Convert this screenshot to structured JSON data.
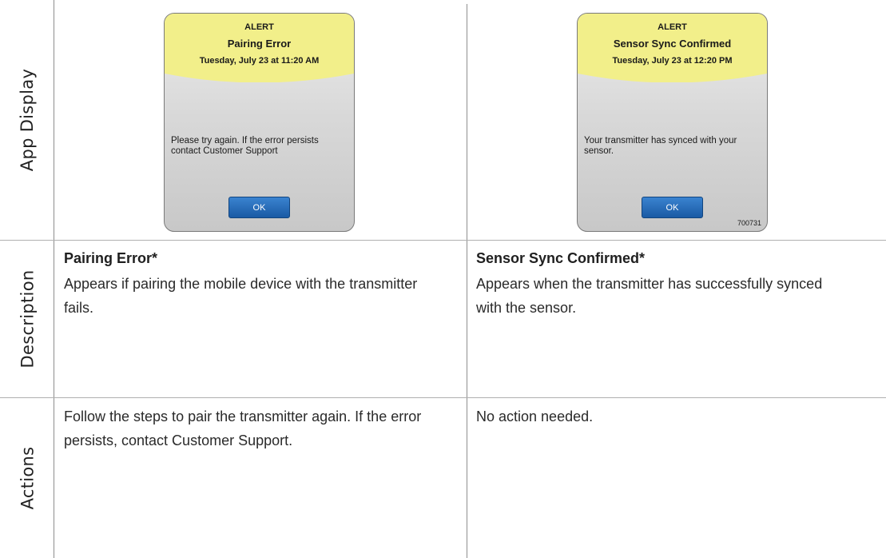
{
  "row_headers": {
    "app_display": "App Display",
    "description": "Description",
    "actions": "Actions"
  },
  "alerts": [
    {
      "kicker": "ALERT",
      "title": "Pairing Error",
      "date": "Tuesday, July 23 at 11:20 AM",
      "message": "Please try again. If the error persists contact Customer Support",
      "ok_label": "OK",
      "code": ""
    },
    {
      "kicker": "ALERT",
      "title": "Sensor Sync Confirmed",
      "date": "Tuesday, July 23 at 12:20 PM",
      "message": "Your transmitter has synced with your sensor.",
      "ok_label": "OK",
      "code": "700731"
    }
  ],
  "descriptions": [
    {
      "title": "Pairing Error*",
      "text": "Appears if pairing the mobile device with the transmitter fails."
    },
    {
      "title": "Sensor Sync Confirmed*",
      "text": "Appears when the transmitter has successfully synced with the sensor."
    }
  ],
  "actions": [
    {
      "text": "Follow the steps to pair the transmitter again. If the error persists, contact Customer Support."
    },
    {
      "text": "No action needed."
    }
  ],
  "colors": {
    "alert_header": "#f2ef8a",
    "ok_button": "#2a6fbe",
    "grid_line": "#8e8e8e"
  }
}
